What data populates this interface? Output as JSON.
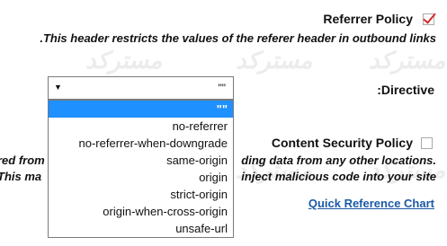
{
  "watermark": "مسترکد",
  "referrer_policy": {
    "title": "Referrer Policy",
    "checked": true,
    "description": ".This header restricts the values of the referer header in outbound links"
  },
  "directive": {
    "label": ":Directive",
    "selected_value": "\"\"",
    "options": [
      "\"\"",
      "no-referrer",
      "no-referrer-when-downgrade",
      "same-origin",
      "origin",
      "strict-origin",
      "origin-when-cross-origin",
      "unsafe-url"
    ]
  },
  "csp": {
    "title": "Content Security Policy",
    "checked": false,
    "desc_line1_left": "red from",
    "desc_line1_right": "ding data from any other locations.",
    "desc_line2_left": "This ma",
    "desc_line2_right": "inject malicious code into your site"
  },
  "quick_reference": "Quick Reference Chart"
}
